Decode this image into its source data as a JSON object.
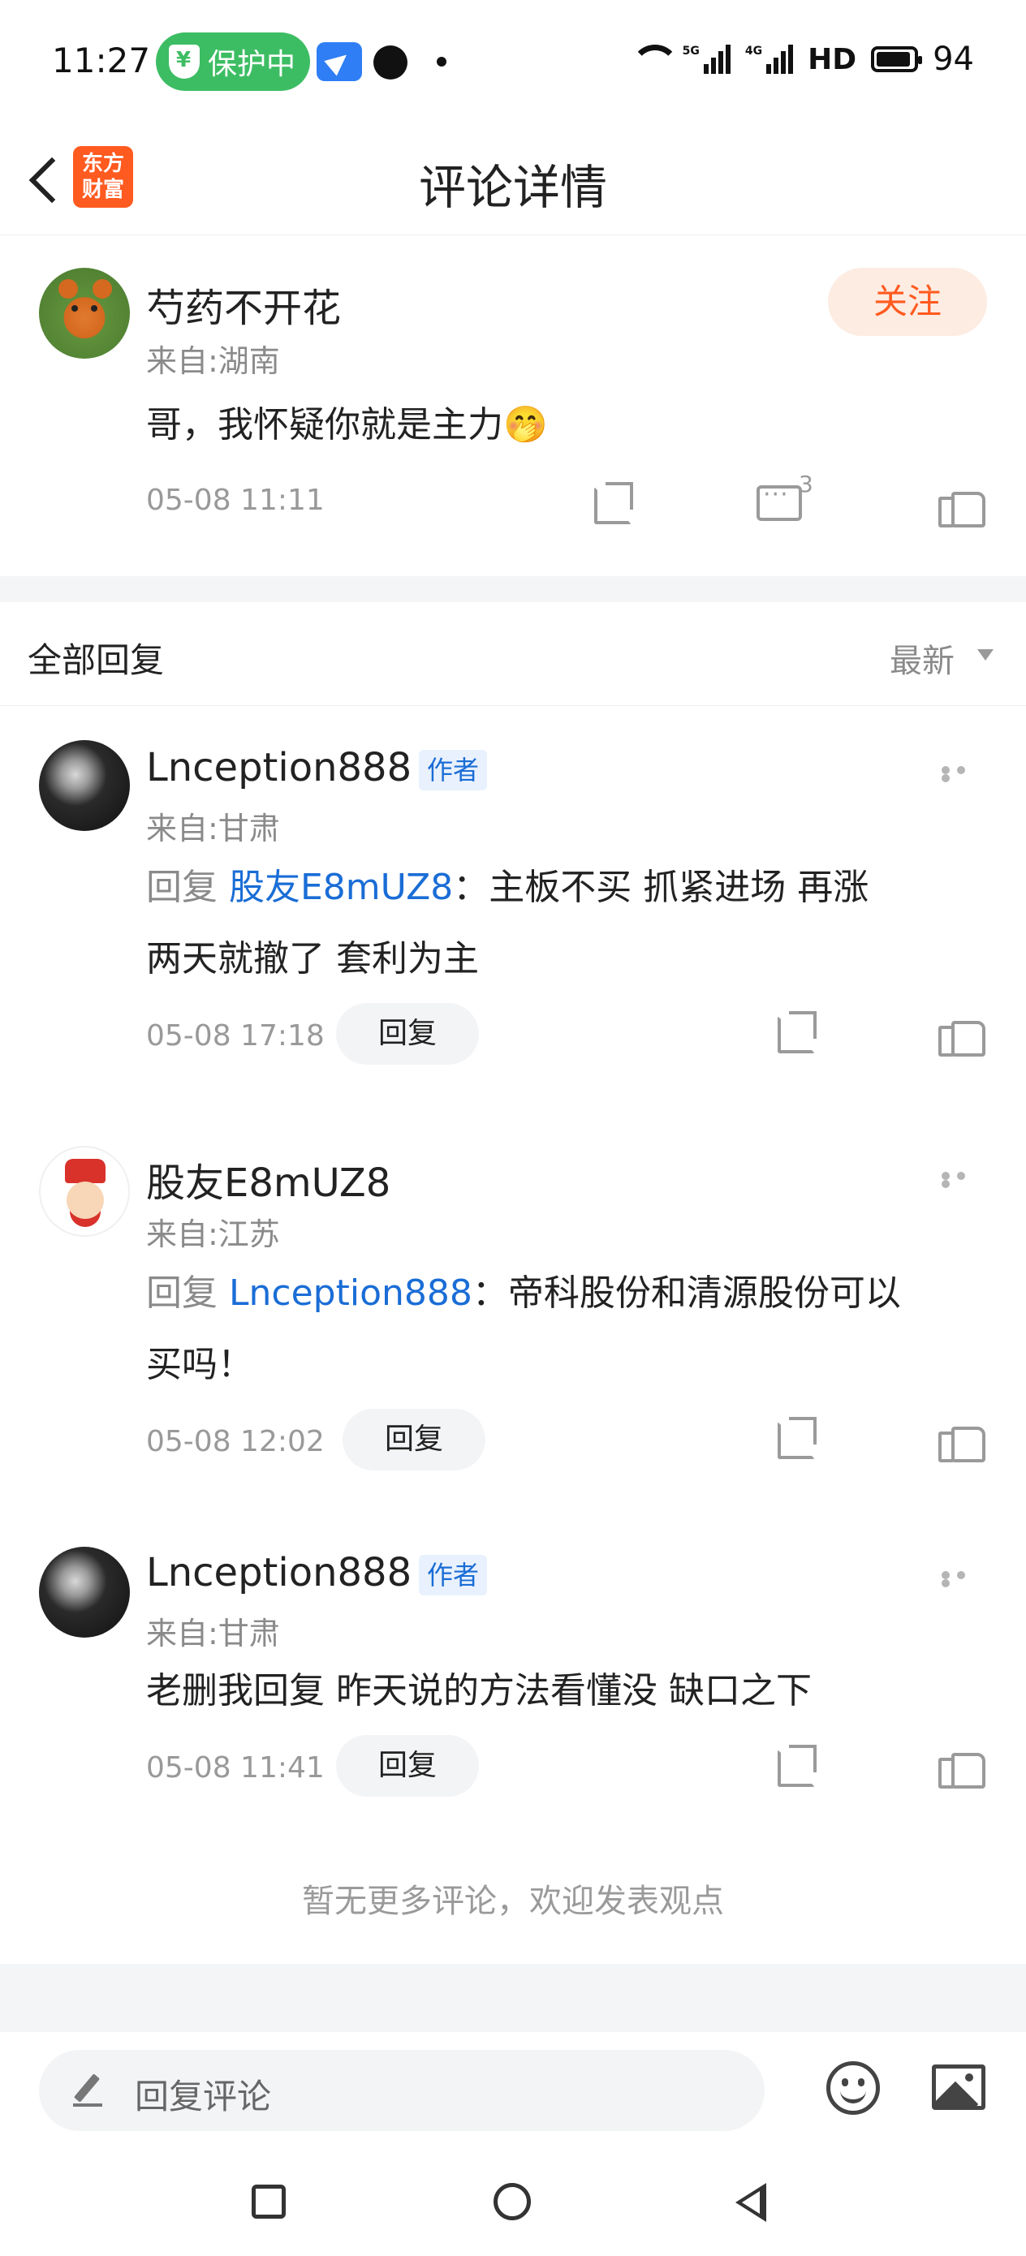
{
  "status_bar": {
    "time": "11:27",
    "protect_label": "保护中",
    "net1": "5G",
    "net2": "4G",
    "hd": "HD",
    "battery": "94",
    "battery_level": 0.94
  },
  "header": {
    "title": "评论详情",
    "logo_text_top": "东方",
    "logo_text_bottom": "财富"
  },
  "main_comment": {
    "username": "芍药不开花",
    "location": "来自:湖南",
    "follow_label": "关注",
    "text": "哥，我怀疑你就是主力🤭",
    "timestamp": "05-08 11:11",
    "reply_count": "3"
  },
  "replies_section": {
    "title": "全部回复",
    "sort_label": "最新"
  },
  "replies": [
    {
      "username": "Lnception888",
      "badge": "作者",
      "location": "来自:甘肃",
      "reply_prefix": "回复",
      "mention": "股友E8mUZ8",
      "text_line1": "：主板不买  抓紧进场  再涨",
      "text_line2": "两天就撤了 套利为主",
      "timestamp": "05-08 17:18",
      "reply_label": "回复"
    },
    {
      "username": "股友E8mUZ8",
      "location": "来自:江苏",
      "reply_prefix": "回复",
      "mention": "Lnception888",
      "text_line1": "：帝科股份和清源股份可以",
      "text_line2": "买吗！",
      "timestamp": "05-08 12:02",
      "reply_label": "回复"
    },
    {
      "username": "Lnception888",
      "badge": "作者",
      "location": "来自:甘肃",
      "text_line1": "老删我回复  昨天说的方法看懂没  缺口之下",
      "timestamp": "05-08 11:41",
      "reply_label": "回复"
    }
  ],
  "footer_note": "暂无更多评论，欢迎发表观点",
  "input_bar": {
    "placeholder": "回复评论"
  }
}
